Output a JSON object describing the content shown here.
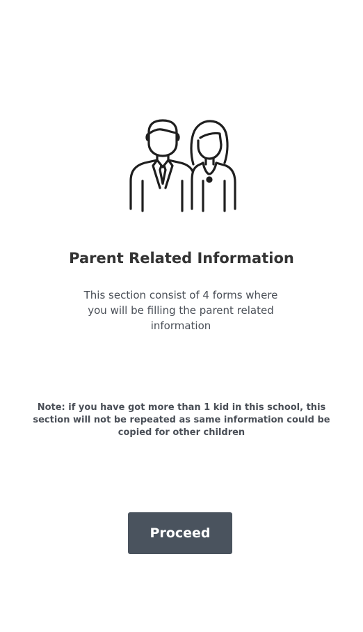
{
  "illustration": {
    "icon": "parents-icon"
  },
  "section": {
    "title": "Parent Related Information",
    "description": "This section consist of 4 forms where you will be filling the parent related information",
    "note": "Note: if you have got more than 1 kid in this school, this section will not be repeated as same information could be copied for other children"
  },
  "actions": {
    "proceed_label": "Proceed"
  },
  "colors": {
    "button_background": "#4a535e",
    "button_text": "#ffffff",
    "title_text": "#333333",
    "body_text": "#4a4f57"
  }
}
